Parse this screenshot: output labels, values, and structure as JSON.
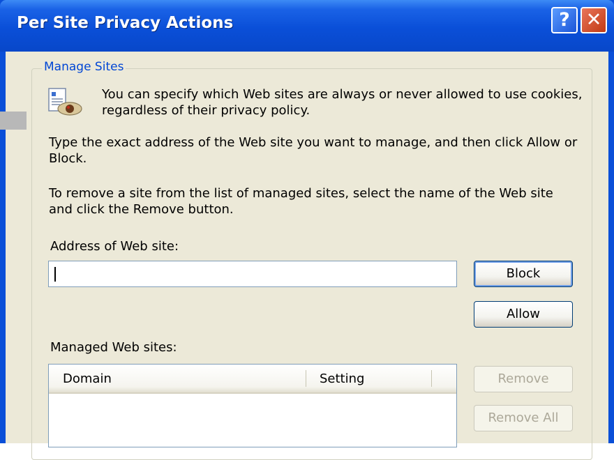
{
  "window": {
    "title": "Per Site Privacy Actions",
    "help_symbol": "?",
    "close_symbol": "✕"
  },
  "group": {
    "label": "Manage Sites",
    "intro": "You can specify which Web sites are always or never allowed to use cookies, regardless of their privacy policy.",
    "para1": "Type the exact address of the Web site you want to manage, and then click Allow or Block.",
    "para2": "To remove a site from the list of managed sites, select the name of the Web site and click the Remove button."
  },
  "address": {
    "label": "Address of Web site:",
    "value": ""
  },
  "buttons": {
    "block": "Block",
    "allow": "Allow",
    "remove": "Remove",
    "remove_all": "Remove All"
  },
  "managed": {
    "label": "Managed Web sites:",
    "columns": [
      "Domain",
      "Setting"
    ],
    "rows": []
  },
  "colors": {
    "title_bar": "#0a4fd8",
    "dialog_bg": "#ece9d8",
    "group_label": "#0046d5"
  },
  "icons": {
    "cookie": "cookie-privacy-icon",
    "help": "help-icon",
    "close": "close-icon"
  }
}
